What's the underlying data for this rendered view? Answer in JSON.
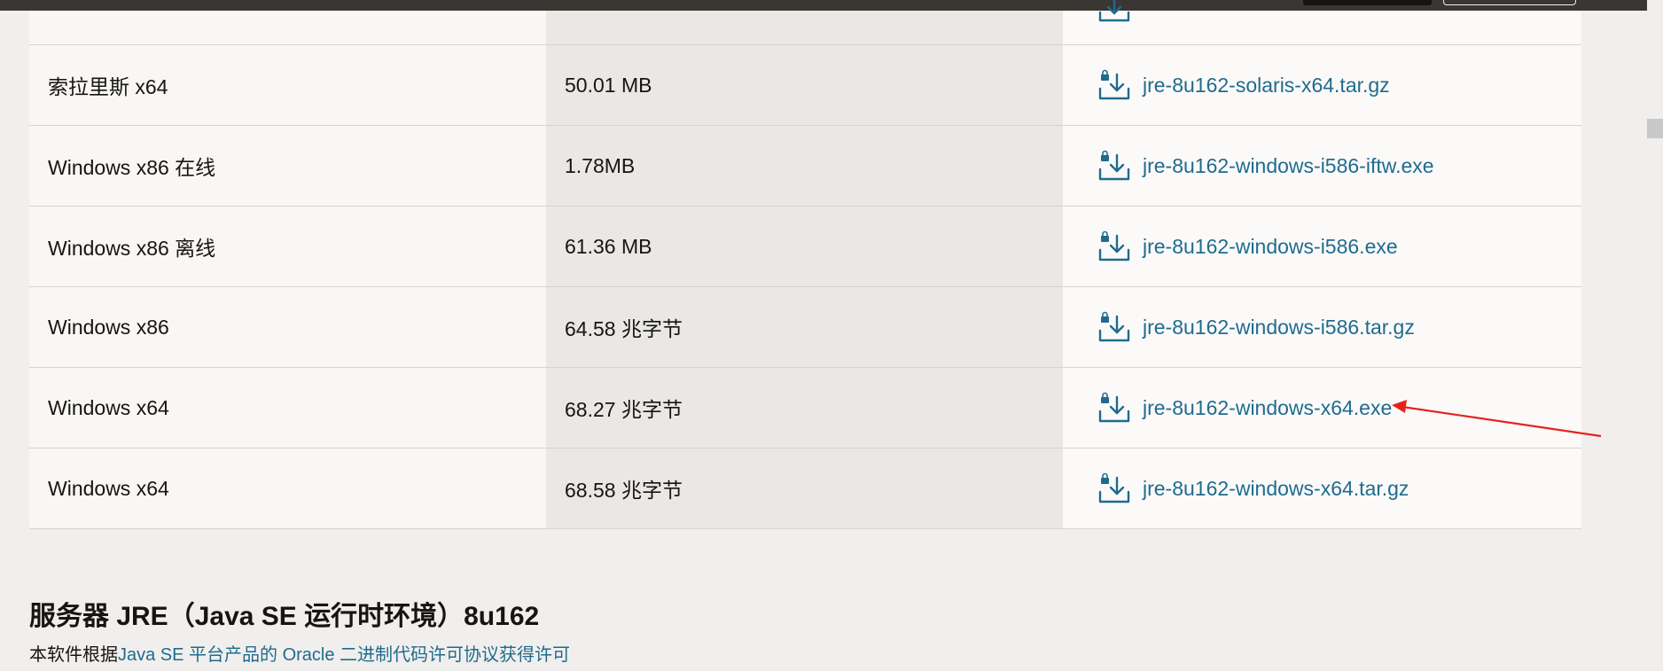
{
  "downloads_table": {
    "rows": [
      {
        "product": "",
        "size": "",
        "file": ""
      },
      {
        "product": "索拉里斯 x64",
        "size": "50.01 MB",
        "file": "jre-8u162-solaris-x64.tar.gz"
      },
      {
        "product": "Windows x86 在线",
        "size": "1.78MB",
        "file": "jre-8u162-windows-i586-iftw.exe"
      },
      {
        "product": "Windows x86 离线",
        "size": "61.36 MB",
        "file": "jre-8u162-windows-i586.exe"
      },
      {
        "product": "Windows x86",
        "size": "64.58 兆字节",
        "file": "jre-8u162-windows-i586.tar.gz"
      },
      {
        "product": "Windows x64",
        "size": "68.27 兆字节",
        "file": "jre-8u162-windows-x64.exe"
      },
      {
        "product": "Windows x64",
        "size": "68.58 兆字节",
        "file": "jre-8u162-windows-x64.tar.gz"
      }
    ]
  },
  "section": {
    "title": "服务器 JRE（Java SE 运行时环境）8u162",
    "note_prefix": "本软件根据",
    "note_link": "Java SE 平台产品的 Oracle 二进制代码许可协议获得许可"
  },
  "colors": {
    "link": "#1f6b8e",
    "annotation_arrow": "#e8221b",
    "topbar": "#3a3632"
  },
  "icons": {
    "download": "download-lock-icon"
  }
}
